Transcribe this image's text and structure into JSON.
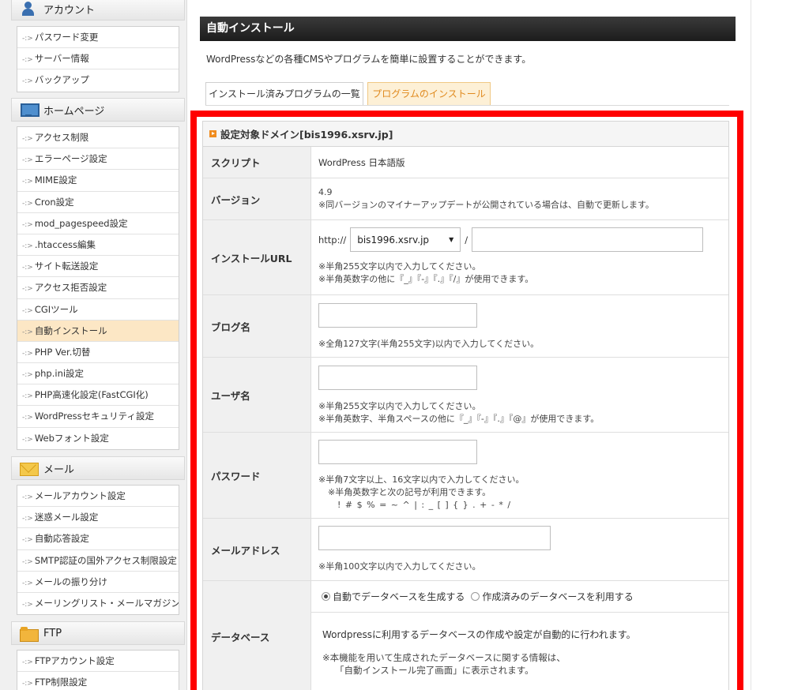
{
  "sidebar": {
    "account": {
      "header": "アカウント",
      "items": [
        "パスワード変更",
        "サーバー情報",
        "バックアップ"
      ]
    },
    "homepage": {
      "header": "ホームページ",
      "items": [
        "アクセス制限",
        "エラーページ設定",
        "MIME設定",
        "Cron設定",
        "mod_pagespeed設定",
        ".htaccess編集",
        "サイト転送設定",
        "アクセス拒否設定",
        "CGIツール",
        "自動インストール",
        "PHP Ver.切替",
        "php.ini設定",
        "PHP高速化設定(FastCGI化)",
        "WordPressセキュリティ設定",
        "Webフォント設定"
      ],
      "active": "自動インストール"
    },
    "mail": {
      "header": "メール",
      "items": [
        "メールアカウント設定",
        "迷惑メール設定",
        "自動応答設定",
        "SMTP認証の国外アクセス制限設定",
        "メールの振り分け",
        "メーリングリスト・メールマガジン"
      ]
    },
    "ftp": {
      "header": "FTP",
      "items": [
        "FTPアカウント設定",
        "FTP制限設定"
      ]
    },
    "arrow": "-:>"
  },
  "main": {
    "title": "自動インストール",
    "description": "WordPressなどの各種CMSやプログラムを簡単に設置することができます。",
    "tabs": {
      "installed": "インストール済みプログラムの一覧",
      "install": "プログラムのインストール"
    }
  },
  "form": {
    "header": "設定対象ドメイン[bis1996.xsrv.jp]",
    "script_label": "スクリプト",
    "script_value": "WordPress 日本語版",
    "version_label": "バージョン",
    "version_value": "4.9",
    "version_note": "※同バージョンのマイナーアップデートが公開されている場合は、自動で更新します。",
    "url_label": "インストールURL",
    "url_prefix": "http://",
    "url_domain": "bis1996.xsrv.jp",
    "url_slash": "/",
    "url_note1": "※半角255文字以内で入力してください。",
    "url_note2": "※半角英数字の他に『_』『-』『.』『/』が使用できます。",
    "blog_label": "ブログ名",
    "blog_note": "※全角127文字(半角255文字)以内で入力してください。",
    "user_label": "ユーザ名",
    "user_note1": "※半角255文字以内で入力してください。",
    "user_note2": "※半角英数字、半角スペースの他に『_』『-』『.』『@』が使用できます。",
    "password_label": "パスワード",
    "password_note1": "※半角7文字以上、16文字以内で入力してください。",
    "password_note2": "※半角英数字と次の記号が利用できます。",
    "password_note3": "! # $ % = ~ ^ | : _ [ ] { } . + - * /",
    "email_label": "メールアドレス",
    "email_note": "※半角100文字以内で入力してください。",
    "db_label": "データベース",
    "db_option_auto": "自動でデータベースを生成する",
    "db_option_existing": "作成済みのデータベースを利用する",
    "db_info": "Wordpressに利用するデータベースの作成や設定が自動的に行われます。",
    "db_note1": "※本機能を用いて生成されたデータベースに関する情報は、",
    "db_note2": "「自動インストール完了画面」に表示されます。"
  }
}
